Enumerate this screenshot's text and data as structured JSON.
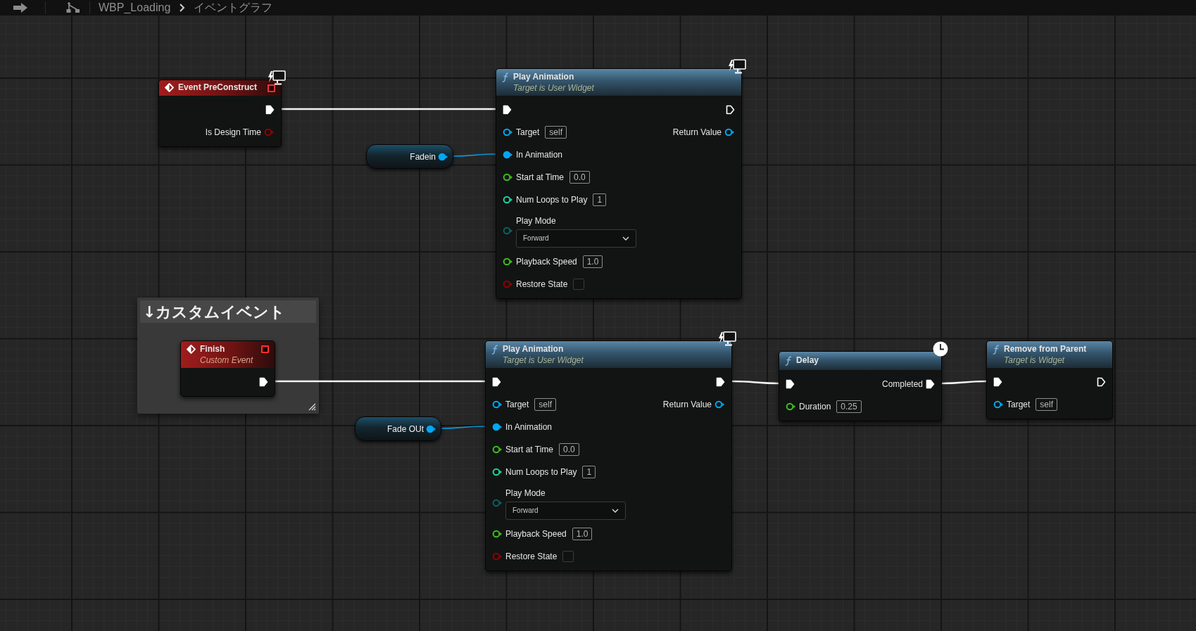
{
  "breadcrumb": {
    "asset": "WBP_Loading",
    "graph": "イベントグラフ"
  },
  "comment": {
    "title": "↓カスタムイベント"
  },
  "nodes": [
    {
      "kind": "event",
      "title": "Event PreConstruct",
      "badge": {
        "kind": "monitor"
      },
      "rows": [
        {
          "out": {
            "kind": "exec",
            "connected": true
          }
        },
        {
          "out": {
            "kind": "data",
            "label": "Is Design Time",
            "color": "#920000",
            "connected": false
          }
        }
      ]
    },
    {
      "kind": "function",
      "title": "Play Animation",
      "subtitle": "Target is User Widget",
      "badge": {
        "kind": "monitor"
      },
      "rows": [
        {
          "in": {
            "kind": "exec",
            "connected": true
          },
          "out": {
            "kind": "exec",
            "connected": false
          }
        },
        {
          "in": {
            "kind": "data",
            "label": "Target",
            "value": "self",
            "color": "#00a8f4",
            "connected": false
          },
          "out": {
            "kind": "data",
            "label": "Return Value",
            "color": "#00a8f4",
            "connected": false
          }
        },
        {
          "in": {
            "kind": "data",
            "label": "In Animation",
            "color": "#00a8f4",
            "connected": true
          }
        },
        {
          "in": {
            "kind": "data",
            "label": "Start at Time",
            "value": "0.0",
            "color": "#3cc21a",
            "connected": false
          }
        },
        {
          "in": {
            "kind": "data",
            "label": "Num Loops to Play",
            "value": "1",
            "color": "#1fd6a0",
            "connected": false
          }
        },
        {
          "in": {
            "kind": "enum",
            "label": "Play Mode",
            "value": "Forward",
            "color": "#0b6262",
            "connected": false
          }
        },
        {
          "in": {
            "kind": "data",
            "label": "Playback Speed",
            "value": "1.0",
            "color": "#3cc21a",
            "connected": false
          }
        },
        {
          "in": {
            "kind": "bool",
            "label": "Restore State",
            "checked": false,
            "color": "#920000",
            "connected": false
          }
        }
      ]
    },
    {
      "kind": "variable",
      "rows": [
        {
          "out": {
            "kind": "data",
            "label": "Fadein",
            "color": "#00a8f4",
            "connected": true
          }
        }
      ]
    },
    {
      "kind": "event",
      "title": "Finish",
      "subtitle": "Custom Event",
      "rows": [
        {
          "out": {
            "kind": "exec",
            "connected": true
          }
        }
      ]
    },
    {
      "kind": "function",
      "title": "Play Animation",
      "subtitle": "Target is User Widget",
      "badge": {
        "kind": "monitor"
      },
      "rows": [
        {
          "in": {
            "kind": "exec",
            "connected": true
          },
          "out": {
            "kind": "exec",
            "connected": true
          }
        },
        {
          "in": {
            "kind": "data",
            "label": "Target",
            "value": "self",
            "color": "#00a8f4",
            "connected": false
          },
          "out": {
            "kind": "data",
            "label": "Return Value",
            "color": "#00a8f4",
            "connected": false
          }
        },
        {
          "in": {
            "kind": "data",
            "label": "In Animation",
            "color": "#00a8f4",
            "connected": true
          }
        },
        {
          "in": {
            "kind": "data",
            "label": "Start at Time",
            "value": "0.0",
            "color": "#3cc21a",
            "connected": false
          }
        },
        {
          "in": {
            "kind": "data",
            "label": "Num Loops to Play",
            "value": "1",
            "color": "#1fd6a0",
            "connected": false
          }
        },
        {
          "in": {
            "kind": "enum",
            "label": "Play Mode",
            "value": "Forward",
            "color": "#0b6262",
            "connected": false
          }
        },
        {
          "in": {
            "kind": "data",
            "label": "Playback Speed",
            "value": "1.0",
            "color": "#3cc21a",
            "connected": false
          }
        },
        {
          "in": {
            "kind": "bool",
            "label": "Restore State",
            "checked": false,
            "color": "#920000",
            "connected": false
          }
        }
      ]
    },
    {
      "kind": "variable",
      "rows": [
        {
          "out": {
            "kind": "data",
            "label": "Fade OUt",
            "color": "#00a8f4",
            "connected": true
          }
        }
      ]
    },
    {
      "kind": "function",
      "title": "Delay",
      "badge": {
        "kind": "clock"
      },
      "rows": [
        {
          "in": {
            "kind": "exec",
            "connected": true
          },
          "out": {
            "kind": "exec",
            "label": "Completed",
            "connected": true
          }
        },
        {
          "in": {
            "kind": "data",
            "label": "Duration",
            "value": "0.25",
            "color": "#3cc21a",
            "connected": false
          }
        }
      ]
    },
    {
      "kind": "function",
      "title": "Remove from Parent",
      "subtitle": "Target is Widget",
      "rows": [
        {
          "in": {
            "kind": "exec",
            "connected": true
          },
          "out": {
            "kind": "exec",
            "connected": false
          }
        },
        {
          "in": {
            "kind": "data",
            "label": "Target",
            "value": "self",
            "color": "#00a8f4",
            "connected": false
          }
        }
      ]
    }
  ]
}
